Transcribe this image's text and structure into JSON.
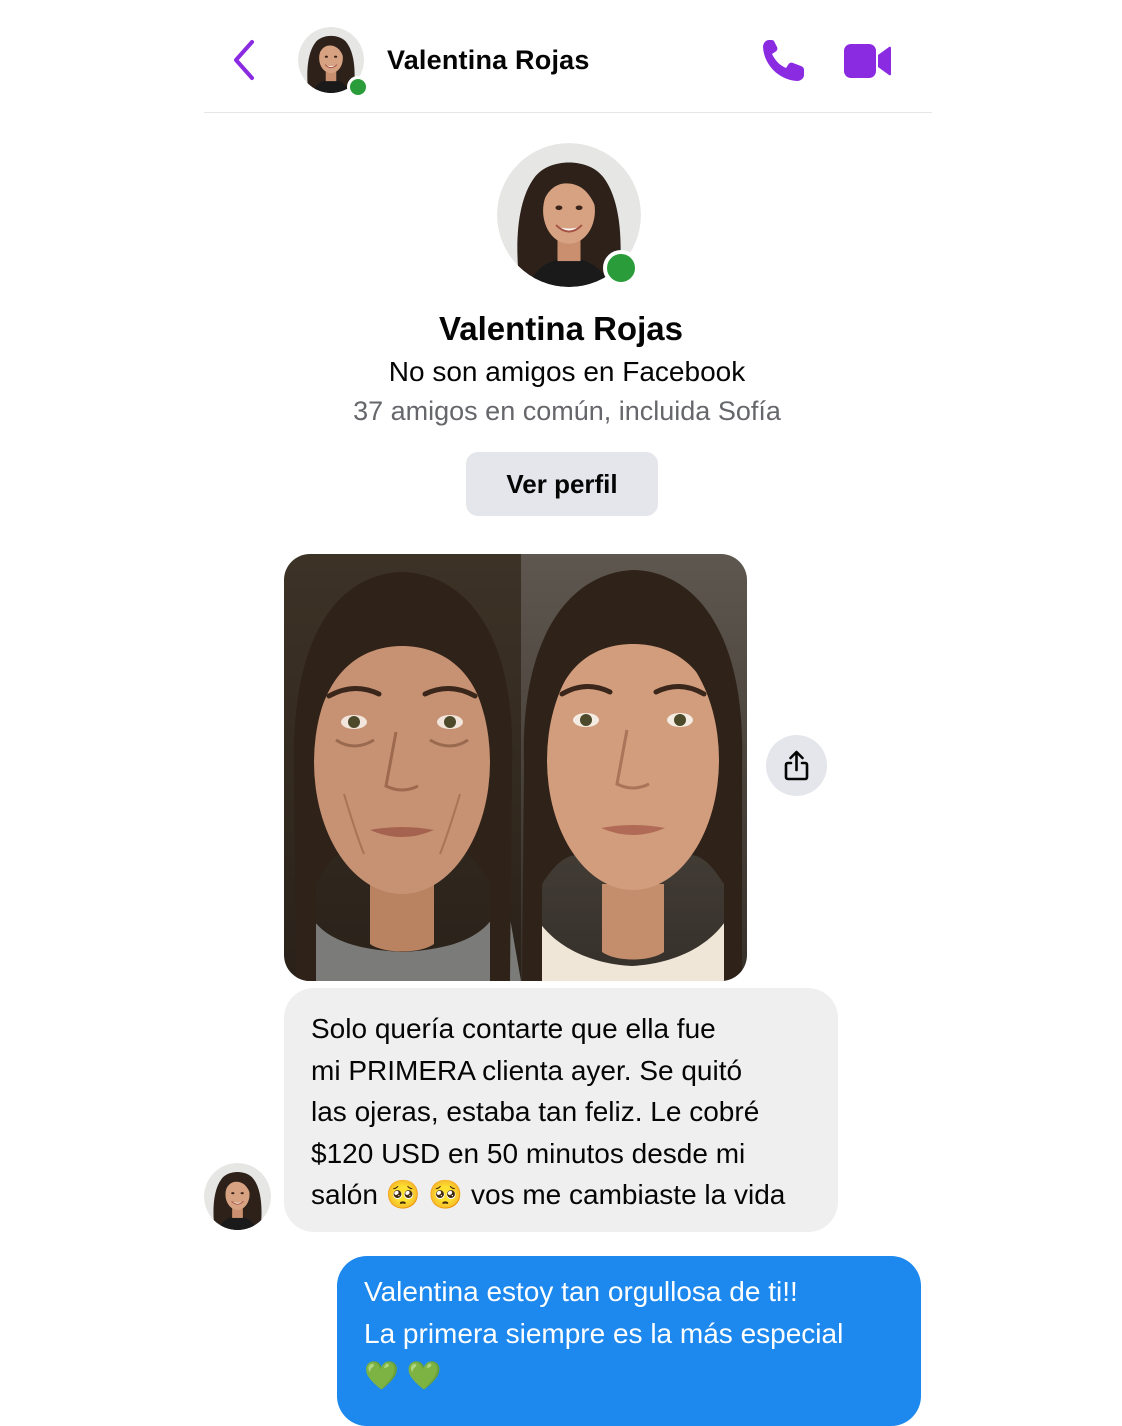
{
  "header": {
    "contact_name": "Valentina Rojas"
  },
  "profile": {
    "name": "Valentina Rojas",
    "relationship": "No son amigos en Facebook",
    "mutual_friends": "37 amigos en común, incluida Sofía",
    "view_profile_label": "Ver perfil"
  },
  "messages": {
    "incoming": {
      "lines": [
        "Solo quería contarte que ella fue",
        "mi PRIMERA clienta ayer. Se quitó",
        "las ojeras, estaba tan feliz. Le cobré",
        "$120 USD en 50 minutos desde mi",
        "salón 🥺 🥺 vos me cambiaste la vida"
      ]
    },
    "outgoing": {
      "lines": [
        "Valentina estoy tan orgullosa de ti!!",
        "La primera siempre es la más especial",
        "💚 💚"
      ]
    }
  },
  "colors": {
    "accent": "#8a2be2",
    "online": "#2a9d3a",
    "outgoing_bubble": "#1d88ee",
    "incoming_bubble": "#efefef",
    "button_bg": "#e4e6eb"
  },
  "icons": {
    "back": "chevron-left-icon",
    "call": "phone-icon",
    "video": "video-camera-icon",
    "share": "share-icon"
  }
}
